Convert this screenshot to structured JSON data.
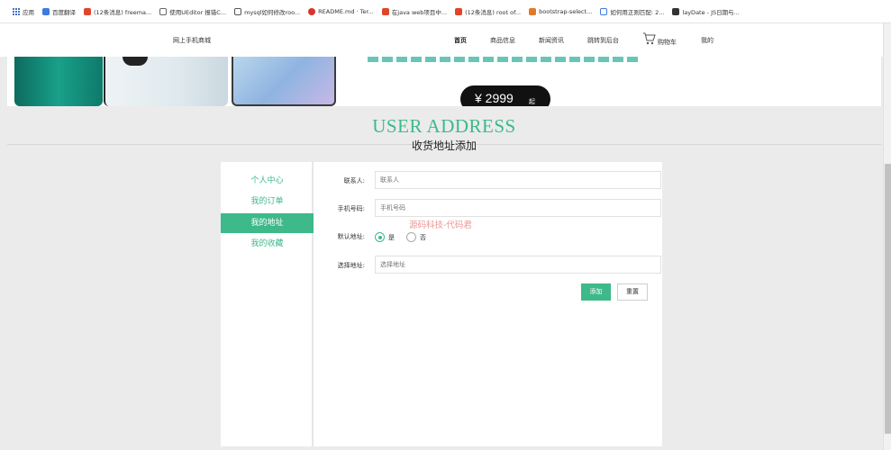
{
  "bookmarks": [
    {
      "label": "应用",
      "color": "#4a72c8",
      "icon": "apps-icon"
    },
    {
      "label": "百度翻译",
      "color": "#3b7be0",
      "icon": "baidu-translate-icon"
    },
    {
      "label": "(12条消息) freema...",
      "color": "#e0452a",
      "icon": "csdn-icon"
    },
    {
      "label": "使用UEditor 报错C...",
      "color": "#666666",
      "icon": "ueditor-icon"
    },
    {
      "label": "mysql如何修改roo...",
      "color": "#555555",
      "icon": "mysql-icon"
    },
    {
      "label": "README.md · Ter...",
      "color": "#d9342b",
      "icon": "gitee-icon"
    },
    {
      "label": "在java web项目中...",
      "color": "#e0452a",
      "icon": "csdn-icon"
    },
    {
      "label": "(12条消息) root of...",
      "color": "#e0452a",
      "icon": "csdn-icon"
    },
    {
      "label": "bootstrap-select...",
      "color": "#e07a2a",
      "icon": "blog-icon"
    },
    {
      "label": "如何用正则匹配: 2...",
      "color": "#3b7be0",
      "icon": "zhihu-icon"
    },
    {
      "label": "layDate - JS日期与...",
      "color": "#333333",
      "icon": "layui-icon"
    }
  ],
  "nav": {
    "brand": "网上手机商城",
    "items": [
      "首页",
      "商品信息",
      "新闻资讯",
      "跳转到后台",
      "购物车",
      "我的"
    ]
  },
  "banner": {
    "price": "¥ 2999",
    "price_suffix": "起"
  },
  "section": {
    "title_en": "USER ADDRESS",
    "title_cn": "收货地址添加"
  },
  "sidebar": {
    "items": [
      "个人中心",
      "我的订单",
      "我的地址",
      "我的收藏"
    ]
  },
  "form": {
    "contact_label": "联系人:",
    "contact_placeholder": "联系人",
    "phone_label": "手机号码:",
    "phone_placeholder": "手机号码",
    "default_label": "默认地址:",
    "opt_yes": "是",
    "opt_no": "否",
    "address_label": "选择地址:",
    "address_placeholder": "选择地址",
    "add_button": "添加",
    "reset_button": "重置"
  },
  "watermark": "源码科技-代码君",
  "colors": {
    "accent": "#3db98a"
  }
}
